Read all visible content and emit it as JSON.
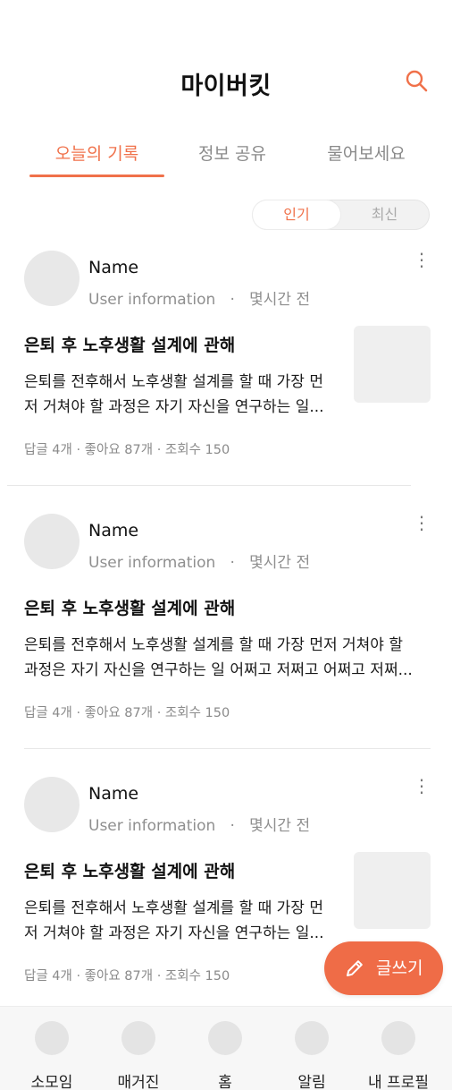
{
  "header": {
    "title": "마이버킷"
  },
  "tabs": [
    {
      "label": "오늘의 기록",
      "active": true
    },
    {
      "label": "정보 공유",
      "active": false
    },
    {
      "label": "물어보세요",
      "active": false
    }
  ],
  "sort": {
    "options": [
      "인기",
      "최신"
    ],
    "selected": "인기"
  },
  "posts": [
    {
      "author_name": "Name",
      "author_info": "User information",
      "time": "몇시간 전",
      "title": "은퇴 후 노후생활 설계에 관해",
      "body_line1": "은퇴를 전후해서 노후생활 설계를 할 때 가장 먼",
      "body_line2": "저 거쳐야 할 과정은 자기 자신을 연구하는 일...",
      "meta": "답글 4개 · 좋아요 87개 · 조회수 150",
      "has_thumbnail": true
    },
    {
      "author_name": "Name",
      "author_info": "User information",
      "time": "몇시간 전",
      "title": "은퇴 후 노후생활 설계에 관해",
      "body_line1": "은퇴를 전후해서 노후생활 설계를 할 때 가장 먼저 거쳐야 할",
      "body_line2": "과정은 자기 자신을 연구하는 일 어쩌고 저쩌고 어쩌고 저쩌...",
      "meta": "답글 4개 · 좋아요 87개 · 조회수 150",
      "has_thumbnail": false
    },
    {
      "author_name": "Name",
      "author_info": "User information",
      "time": "몇시간 전",
      "title": "은퇴 후 노후생활 설계에 관해",
      "body_line1": "은퇴를 전후해서 노후생활 설계를 할 때 가장 먼",
      "body_line2": "저 거쳐야 할 과정은 자기 자신을 연구하는 일...",
      "meta": "답글 4개 · 좋아요 87개 · 조회수 150",
      "has_thumbnail": true
    }
  ],
  "fab": {
    "label": "글쓰기",
    "icon": "pencil-icon"
  },
  "bottom_nav": [
    {
      "label": "소모임"
    },
    {
      "label": "매거진"
    },
    {
      "label": "홈"
    },
    {
      "label": "알림"
    },
    {
      "label": "내 프로필"
    }
  ],
  "colors": {
    "accent": "#f0714a",
    "fab": "#ef6c47",
    "placeholder": "#e8e8e8"
  },
  "icons": {
    "search": "search-icon",
    "more": "more-vertical-icon",
    "write": "pencil-icon"
  }
}
